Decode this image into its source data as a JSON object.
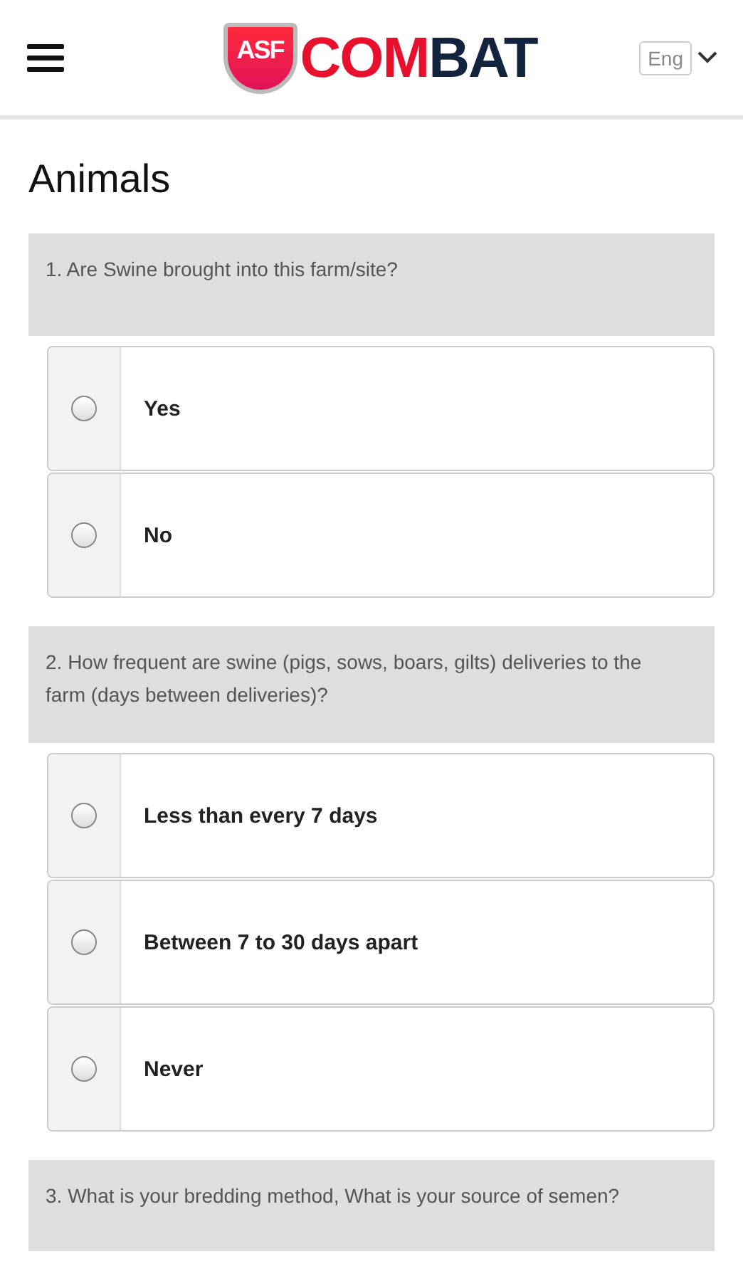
{
  "header": {
    "logo": {
      "badge": "ASF",
      "word": [
        {
          "text": "COM",
          "color": "#e8112d"
        },
        {
          "text": "BAT",
          "color": "#13243f"
        }
      ]
    },
    "language": "Eng"
  },
  "title": "Animals",
  "questions": [
    {
      "text": "1. Are Swine brought into this farm/site?",
      "options": [
        {
          "label": "Yes",
          "selected": false
        },
        {
          "label": "No",
          "selected": false
        }
      ]
    },
    {
      "text": "2. How frequent are swine (pigs, sows, boars, gilts) deliveries to the farm (days between deliveries)?",
      "options": [
        {
          "label": "Less than every 7 days",
          "selected": false
        },
        {
          "label": "Between 7 to 30 days apart",
          "selected": false
        },
        {
          "label": "Never",
          "selected": false
        }
      ]
    },
    {
      "text": "3. What is your bredding method, What is your source of semen?"
    }
  ]
}
